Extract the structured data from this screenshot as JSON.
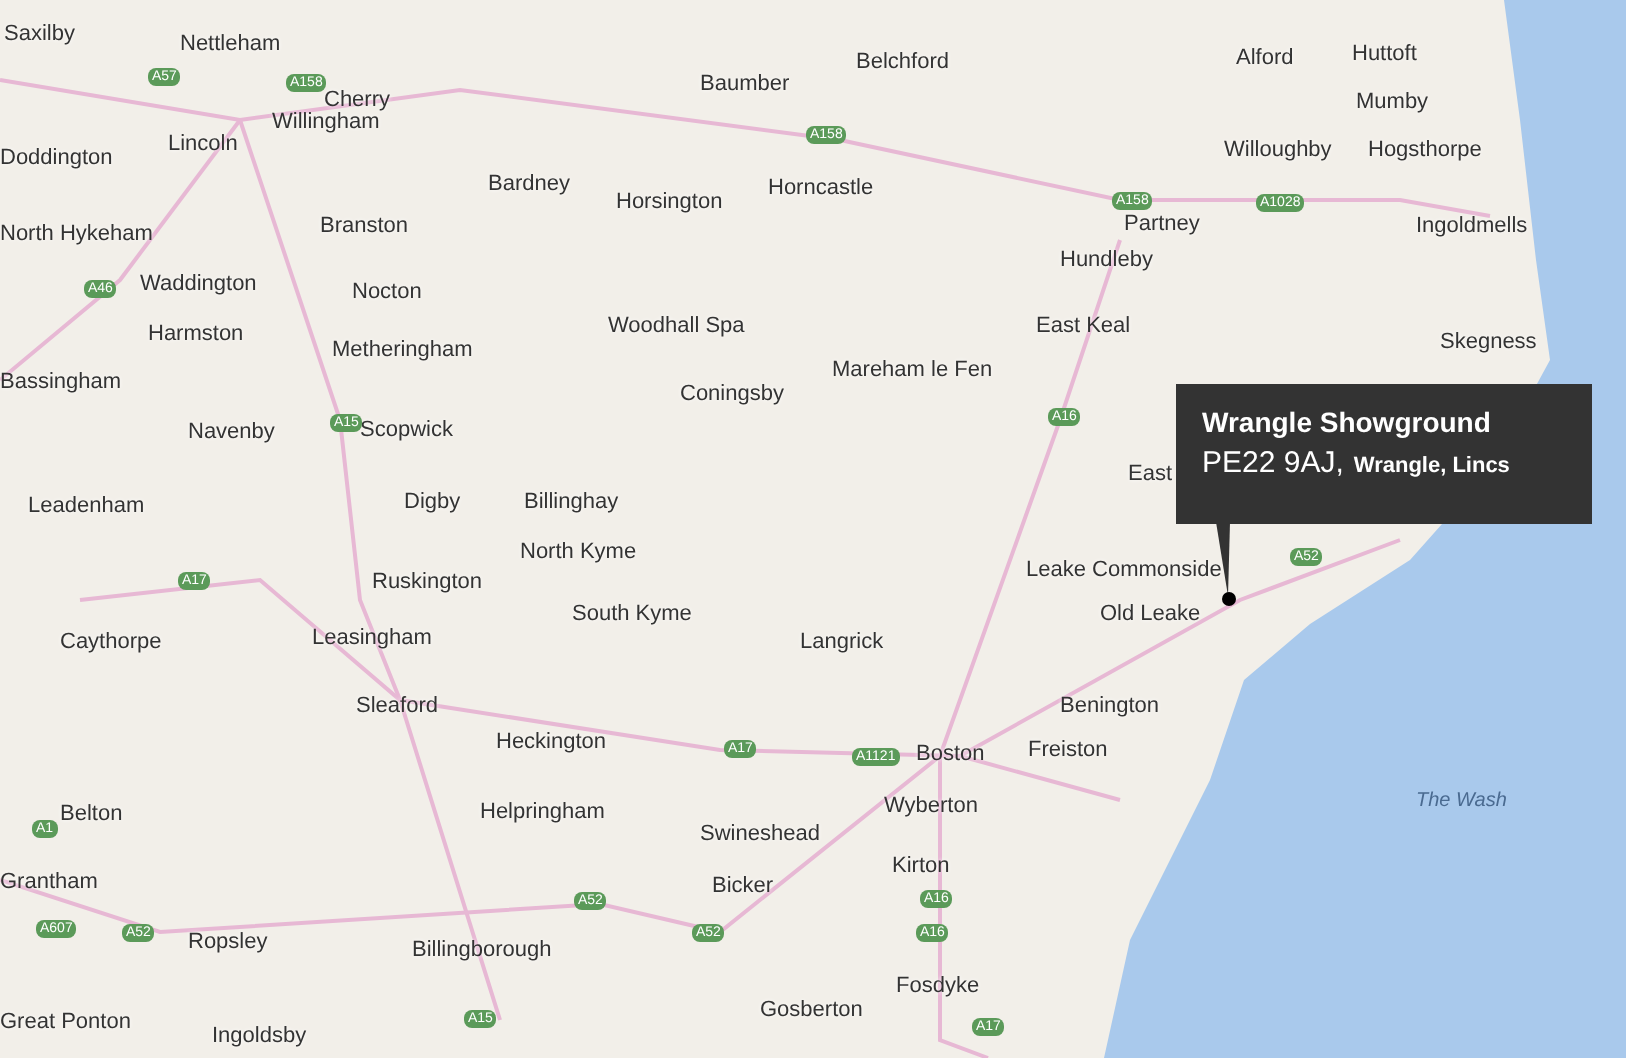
{
  "places": [
    "Saxilby",
    "Nettleham",
    "Belchford",
    "Alford",
    "Huttoft",
    "Cherry",
    "Baumber",
    "Mumby",
    "Willingham",
    "Doddington",
    "Lincoln",
    "Willoughby",
    "Hogsthorpe",
    "Bardney",
    "Horsington",
    "Horncastle",
    "North Hykeham",
    "Branston",
    "Partney",
    "Ingoldmells",
    "Hundleby",
    "Waddington",
    "Nocton",
    "Harmston",
    "Metheringham",
    "Woodhall Spa",
    "East Keal",
    "Skegness",
    "Bassingham",
    "Coningsby",
    "Mareham le Fen",
    "Navenby",
    "Scopwick",
    "East",
    "Leadenham",
    "Digby",
    "Billinghay",
    "North Kyme",
    "Ruskington",
    "Leake Commonside",
    "South Kyme",
    "Old Leake",
    "Caythorpe",
    "Leasingham",
    "Langrick",
    "Sleaford",
    "Benington",
    "Heckington",
    "Boston",
    "Freiston",
    "Belton",
    "Helpringham",
    "Wyberton",
    "Swineshead",
    "Grantham",
    "Bicker",
    "Kirton",
    "Ropsley",
    "Billingborough",
    "Fosdyke",
    "Great Ponton",
    "Ingoldsby",
    "Gosberton"
  ],
  "roads": [
    "A57",
    "A158",
    "A158",
    "A46",
    "A15",
    "A17",
    "A158",
    "A1028",
    "A16",
    "A52",
    "A17",
    "A1121",
    "A1",
    "A607",
    "A52",
    "A52",
    "A52",
    "A16",
    "A16",
    "A15",
    "A17"
  ],
  "sea_label": "The Wash",
  "callout": {
    "title": "Wrangle Showground",
    "postcode": "PE22 9AJ,",
    "locality": "Wrangle, Lincs"
  }
}
